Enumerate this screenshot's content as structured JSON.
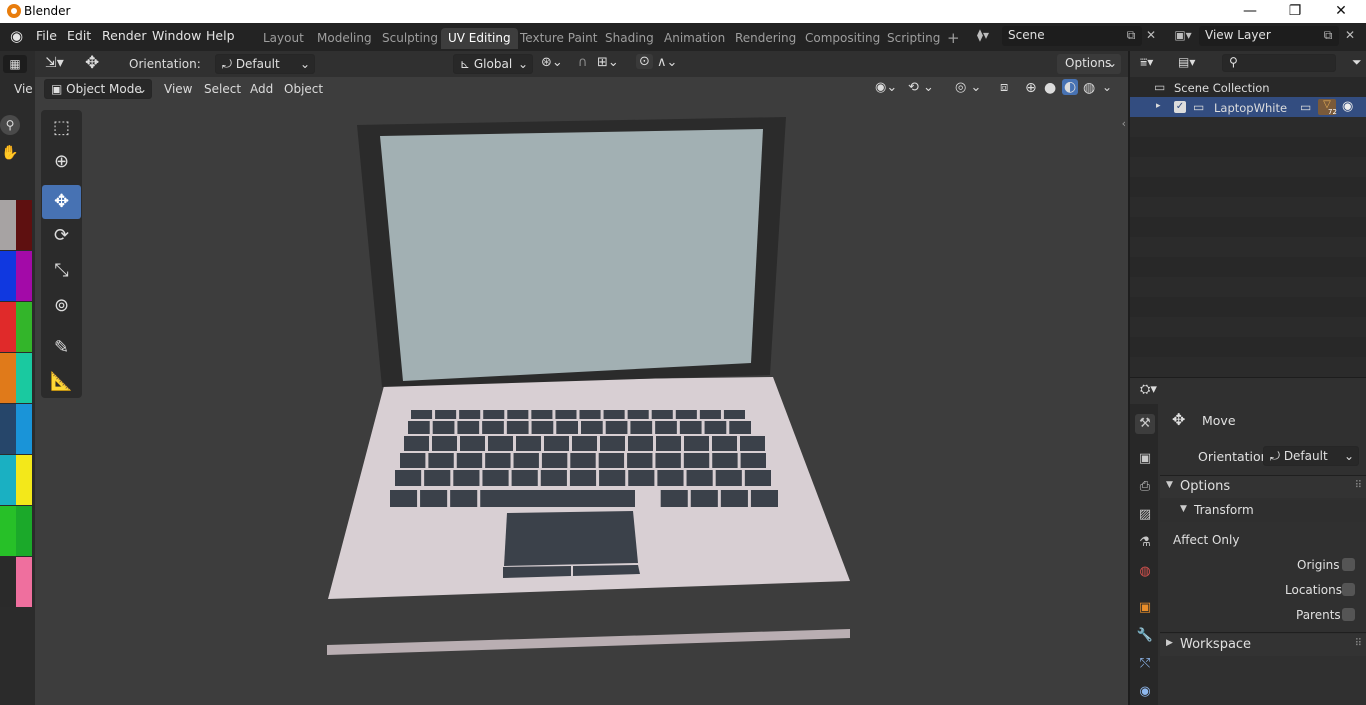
{
  "window": {
    "title": "Blender",
    "minimize": "—",
    "restore": "❐",
    "close": "✕"
  },
  "menu": [
    "File",
    "Edit",
    "Render",
    "Window",
    "Help"
  ],
  "workspaces": [
    "Layout",
    "Modeling",
    "Sculpting",
    "UV Editing",
    "Texture Paint",
    "Shading",
    "Animation",
    "Rendering",
    "Compositing",
    "Scripting"
  ],
  "add_workspace": "+",
  "scene": {
    "label": "Scene"
  },
  "view_layer": {
    "label": "View Layer"
  },
  "viewport_header": {
    "orientation_label": "Orientation:",
    "orientation_value": "Default",
    "transform_space": "Global",
    "options": "Options",
    "mode": "Object Mode",
    "menus": [
      "View",
      "Select",
      "Add",
      "Object"
    ],
    "left_label": "Vie"
  },
  "outliner": {
    "root": "Scene Collection",
    "items": [
      {
        "name": "LaptopWhite"
      }
    ],
    "badge": "72"
  },
  "properties": {
    "tool": "Move",
    "orientation_label": "Orientation",
    "orientation_value": "Default",
    "options_panel": "Options",
    "transform_panel": "Transform",
    "affect_only": "Affect Only",
    "origins": "Origins",
    "locations": "Locations",
    "parents": "Parents",
    "workspace_panel": "Workspace"
  },
  "palette": {
    "colors": [
      "#a7a3a3",
      "#5e1010",
      "#1038e0",
      "#a30aa8",
      "#e02a2a",
      "#33b52a",
      "#e07a1a",
      "#1ac9a0",
      "#26466a",
      "#1a94d8",
      "#1ab0c2",
      "#f3e81a",
      "#27c028",
      "#1ba92a",
      "#2a2a2a",
      "#ef6f9e"
    ]
  },
  "colors": {
    "accent": "#4772b3",
    "viewport_bg": "#3d3d3d",
    "screen": "#a2b0b3",
    "body": "#d8cfd3",
    "keys": "#3b414a"
  }
}
